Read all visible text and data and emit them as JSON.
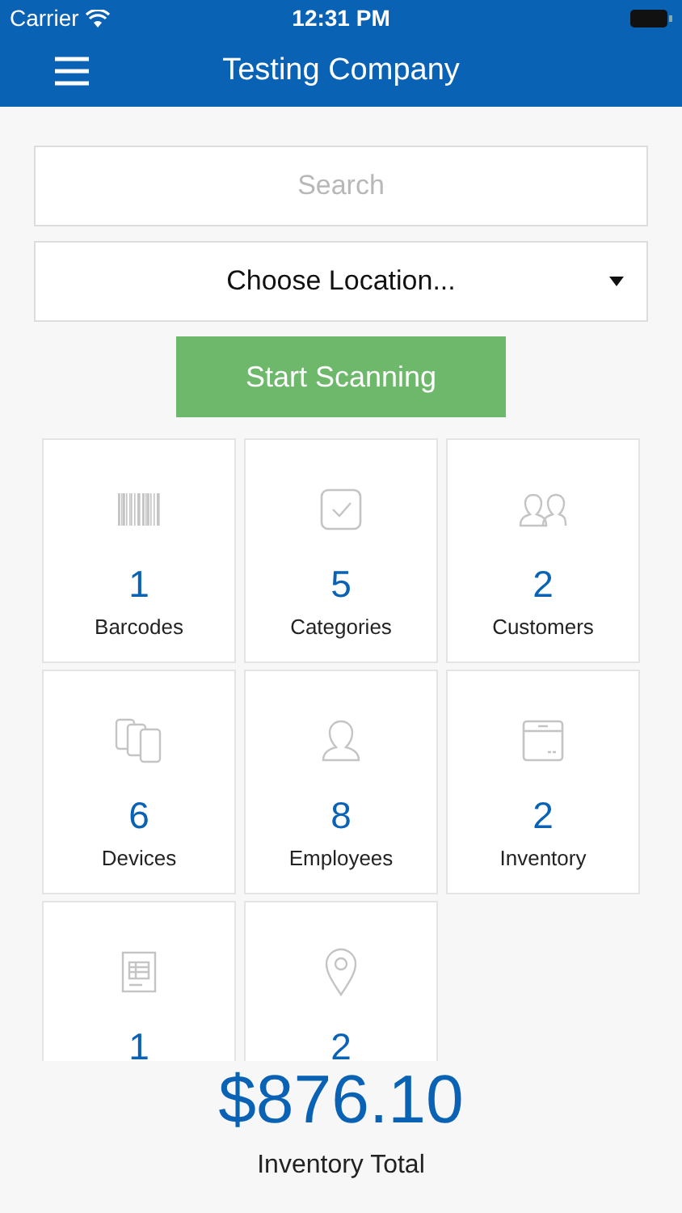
{
  "status_bar": {
    "carrier": "Carrier",
    "time": "12:31 PM"
  },
  "nav": {
    "title": "Testing Company"
  },
  "search": {
    "placeholder": "Search"
  },
  "location": {
    "value": "Choose Location..."
  },
  "scan_button": {
    "label": "Start Scanning"
  },
  "tiles": [
    {
      "kind": "barcode",
      "count": "1",
      "label": "Barcodes"
    },
    {
      "kind": "check",
      "count": "5",
      "label": "Categories"
    },
    {
      "kind": "people",
      "count": "2",
      "label": "Customers"
    },
    {
      "kind": "devices",
      "count": "6",
      "label": "Devices"
    },
    {
      "kind": "person",
      "count": "8",
      "label": "Employees"
    },
    {
      "kind": "box",
      "count": "2",
      "label": "Inventory"
    },
    {
      "kind": "sheet",
      "count": "1"
    },
    {
      "kind": "pin",
      "count": "2"
    }
  ],
  "total": {
    "amount": "$876.10",
    "label": "Inventory Total"
  }
}
